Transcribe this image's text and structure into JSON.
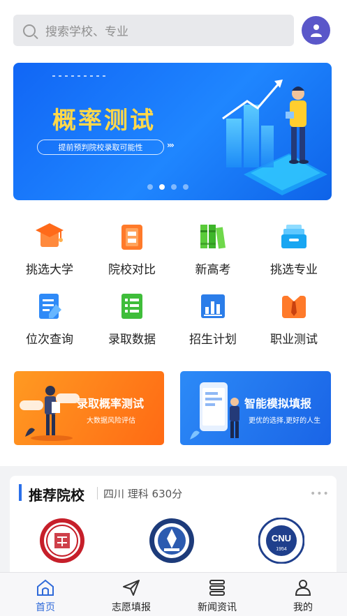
{
  "search": {
    "placeholder": "搜索学校、专业",
    "icon": "search-icon"
  },
  "user_icon": "user-icon",
  "banner": {
    "title": "概率测试",
    "subtitle": "提前预判院校录取可能性",
    "arrows": "›››",
    "active_slide": 1,
    "slide_count": 4
  },
  "grid": {
    "items": [
      {
        "label": "挑选大学",
        "icon": "graduation-cap-icon"
      },
      {
        "label": "院校对比",
        "icon": "compare-document-icon"
      },
      {
        "label": "新高考",
        "icon": "books-icon"
      },
      {
        "label": "挑选专业",
        "icon": "inbox-tray-icon"
      },
      {
        "label": "位次查询",
        "icon": "edit-document-icon"
      },
      {
        "label": "录取数据",
        "icon": "list-document-icon"
      },
      {
        "label": "招生计划",
        "icon": "bar-chart-icon"
      },
      {
        "label": "职业测试",
        "icon": "necktie-shirt-icon"
      }
    ]
  },
  "promos": {
    "left": {
      "title": "录取概率测试",
      "subtitle": "大数据风险评估"
    },
    "right": {
      "title": "智能模拟填报",
      "subtitle": "更优的选择,更好的人生"
    }
  },
  "recommend": {
    "title": "推荐院校",
    "meta": "四川 理科 630分",
    "more": "•••",
    "schools": [
      {
        "name": "fu-seal-icon"
      },
      {
        "name": "university-seal-icon"
      },
      {
        "name": "cnu-seal-icon",
        "text": "CNU",
        "year": "1954"
      }
    ]
  },
  "nav": {
    "items": [
      {
        "label": "首页",
        "icon": "home-icon",
        "active": true
      },
      {
        "label": "志愿填报",
        "icon": "send-icon",
        "active": false
      },
      {
        "label": "新闻资讯",
        "icon": "news-icon",
        "active": false
      },
      {
        "label": "我的",
        "icon": "person-icon",
        "active": false
      }
    ]
  },
  "colors": {
    "accent": "#2f6ad9",
    "banner": "#1a7af8",
    "banner_title": "#ffd84a",
    "avatar": "#5a57c9",
    "promo_orange": "#ff7a16",
    "promo_blue": "#2477ee"
  }
}
